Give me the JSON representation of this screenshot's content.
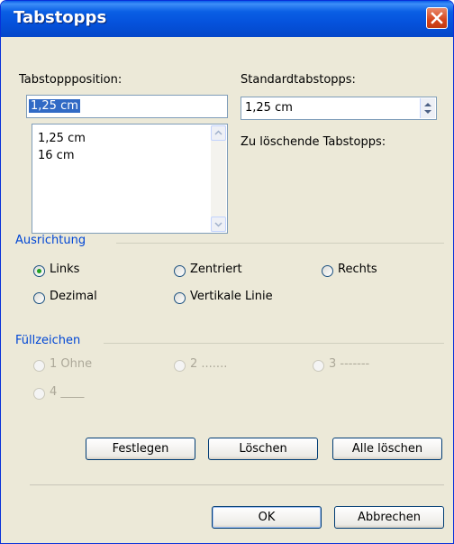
{
  "window": {
    "title": "Tabstopps"
  },
  "tab_position": {
    "label": "Tabstoppposition:",
    "value": "1,25 cm",
    "list": [
      "1,25 cm",
      "16 cm"
    ]
  },
  "default_tabs": {
    "label": "Standardtabstopps:",
    "value": "1,25 cm"
  },
  "to_delete": {
    "label": "Zu löschende Tabstopps:"
  },
  "alignment": {
    "label": "Ausrichtung",
    "options": [
      "Links",
      "Zentriert",
      "Rechts",
      "Dezimal",
      "Vertikale Linie"
    ],
    "selected": "Links"
  },
  "leader": {
    "label": "Füllzeichen",
    "options": [
      "1 Ohne",
      "2 .......",
      "3 -------",
      "4 ____"
    ]
  },
  "buttons": {
    "set": "Festlegen",
    "clear": "Löschen",
    "clear_all": "Alle löschen",
    "ok": "OK",
    "cancel": "Abbrechen"
  },
  "colors": {
    "titlebar": "#0553dc",
    "group_label": "#0046d5",
    "selection": "#316ac5",
    "radio_dot": "#21a121"
  }
}
